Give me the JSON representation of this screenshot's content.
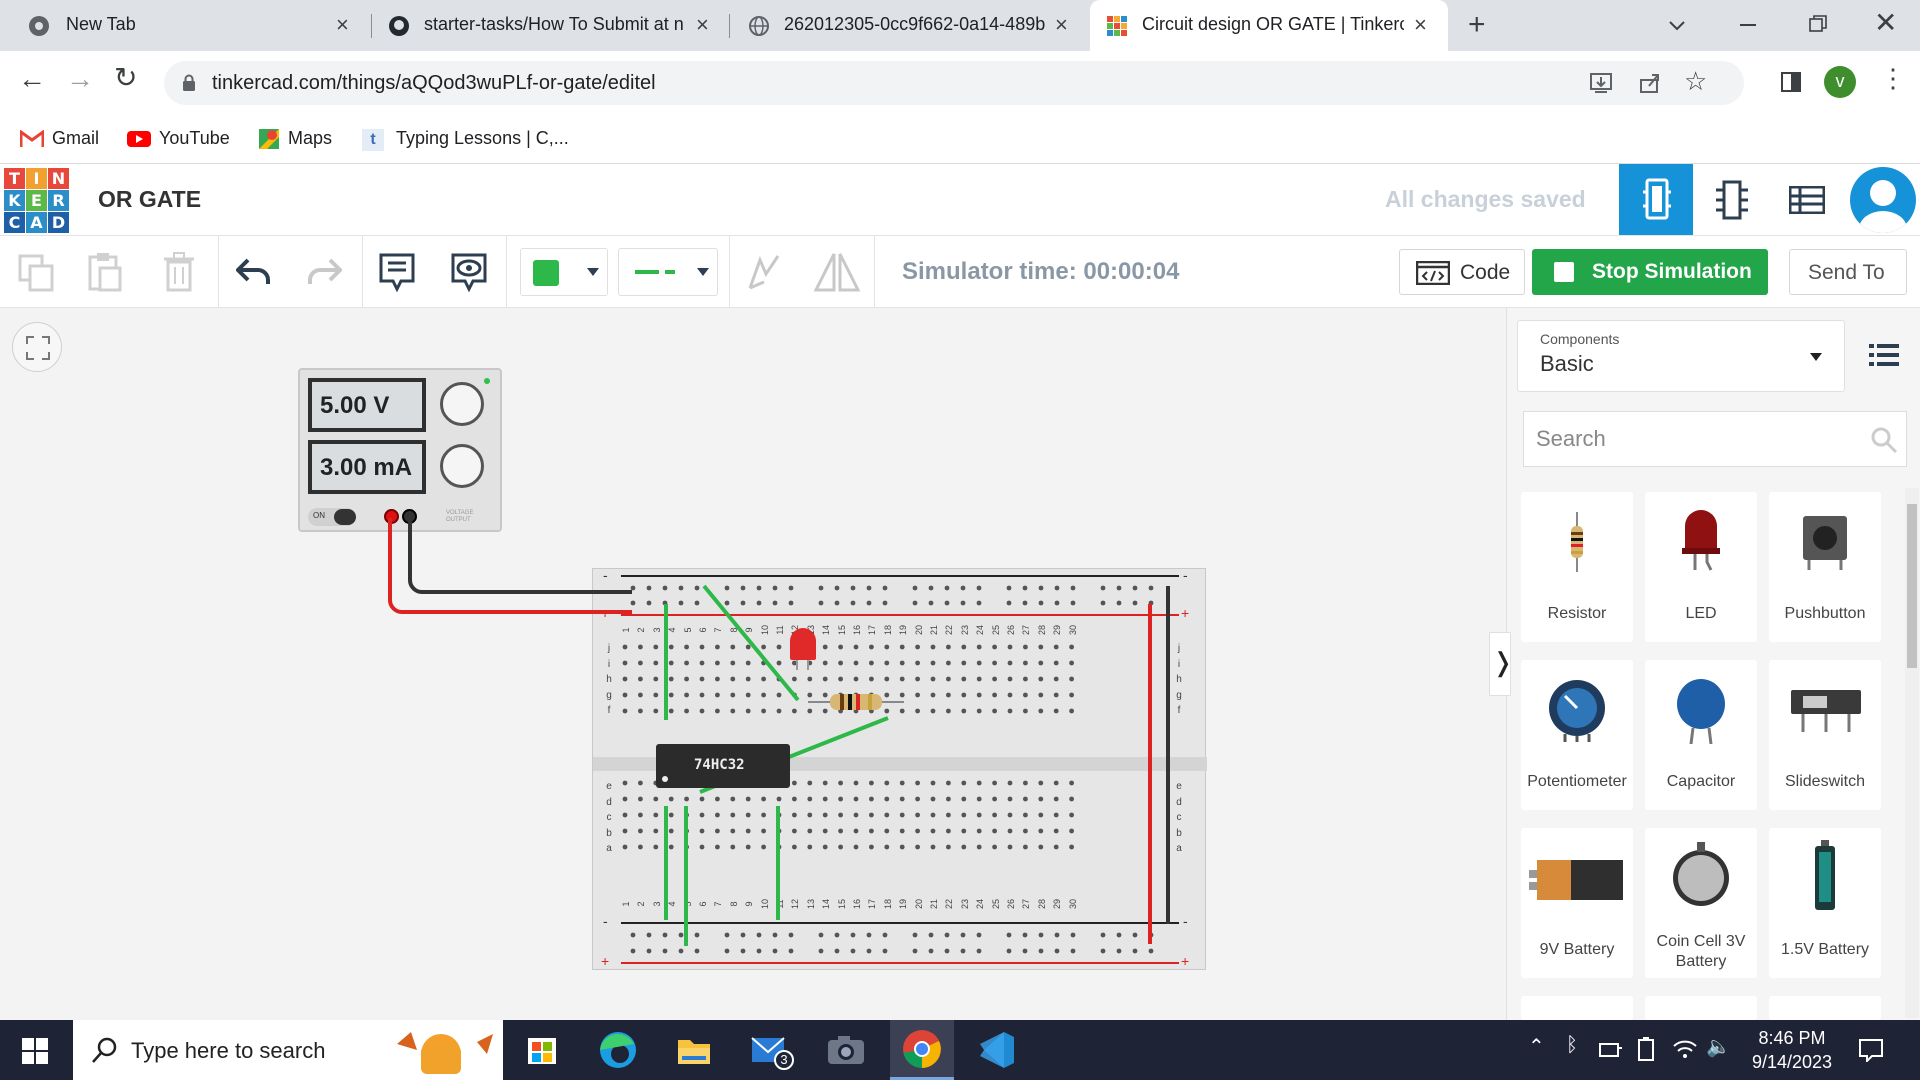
{
  "browser": {
    "tabs": [
      {
        "label": "New Tab",
        "icon": "chrome-icon"
      },
      {
        "label": "starter-tasks/How To Submit at n",
        "icon": "github-icon"
      },
      {
        "label": "262012305-0cc9f662-0a14-489b",
        "icon": "globe-icon"
      },
      {
        "label": "Circuit design OR GATE | Tinkerca",
        "icon": "tinkercad-icon"
      }
    ],
    "url": "tinkercad.com/things/aQQod3wuPLf-or-gate/editel",
    "profile_initial": "v",
    "bookmarks": [
      "Gmail",
      "YouTube",
      "Maps",
      "Typing Lessons | C,..."
    ]
  },
  "app": {
    "logo_letters": [
      "T",
      "I",
      "N",
      "K",
      "E",
      "R",
      "C",
      "A",
      "D"
    ],
    "title": "OR GATE",
    "save_status": "All changes saved"
  },
  "toolbar": {
    "sim_time": "Simulator time: 00:00:04",
    "code_label": "Code",
    "stop_label": "Stop Simulation",
    "sendto_label": "Send To",
    "color_swatch": "#2eb84a"
  },
  "circuit": {
    "power_supply": {
      "voltage": "5.00 V",
      "current": "3.00 mA",
      "on_label": "ON",
      "output_label": "VOLTAGE OUTPUT"
    },
    "chip_label": "74HC32",
    "breadboard_numbers": [
      "1",
      "2",
      "3",
      "4",
      "5",
      "6",
      "7",
      "8",
      "9",
      "10",
      "11",
      "12",
      "13",
      "14",
      "15",
      "16",
      "17",
      "18",
      "19",
      "20",
      "21",
      "22",
      "23",
      "24",
      "25",
      "26",
      "27",
      "28",
      "29",
      "30"
    ],
    "breadboard_rows_top": [
      "j",
      "i",
      "h",
      "g",
      "f"
    ],
    "breadboard_rows_bottom": [
      "e",
      "d",
      "c",
      "b",
      "a"
    ],
    "rail_minus": "-",
    "rail_plus": "+"
  },
  "panel": {
    "components_caption": "Components",
    "components_value": "Basic",
    "search_placeholder": "Search",
    "components": [
      "Resistor",
      "LED",
      "Pushbutton",
      "Potentiometer",
      "Capacitor",
      "Slideswitch",
      "9V Battery",
      "Coin Cell 3V Battery",
      "1.5V Battery"
    ]
  },
  "taskbar": {
    "search_placeholder": "Type here to search",
    "mail_badge": "3",
    "time": "8:46 PM",
    "date": "9/14/2023"
  }
}
